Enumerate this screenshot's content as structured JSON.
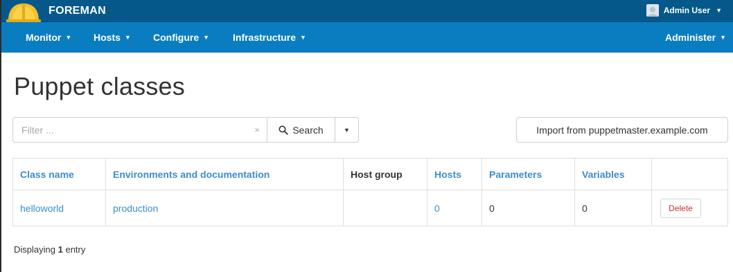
{
  "header": {
    "brand": "FOREMAN",
    "user": "Admin User"
  },
  "nav": {
    "left": [
      "Monitor",
      "Hosts",
      "Configure",
      "Infrastructure"
    ],
    "right": "Administer"
  },
  "page": {
    "title": "Puppet classes"
  },
  "search": {
    "placeholder": "Filter ...",
    "clear": "×",
    "button_label": "Search"
  },
  "import_button": "Import from puppetmaster.example.com",
  "table": {
    "headers": [
      "Class name",
      "Environments and documentation",
      "Host group",
      "Hosts",
      "Parameters",
      "Variables"
    ],
    "rows": [
      {
        "class_name": "helloworld",
        "environment": "production",
        "host_group": "",
        "hosts": "0",
        "parameters": "0",
        "variables": "0",
        "action": "Delete"
      }
    ]
  },
  "footer": {
    "prefix": "Displaying",
    "count": "1",
    "suffix": "entry"
  },
  "colors": {
    "header_bg": "#04598a",
    "nav_bg": "#0a7dc1",
    "link": "#3a8dd0",
    "delete": "#c9302c"
  }
}
